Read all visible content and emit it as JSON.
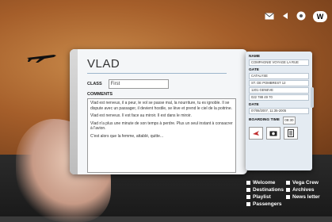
{
  "topbar": {
    "icons": [
      "mail-icon",
      "arrow-left-icon",
      "globe-icon"
    ],
    "badge": "W"
  },
  "card": {
    "title": "VLAD",
    "class_label": "CLASS",
    "class_value": "First",
    "comments_label": "COMMENTS",
    "comments": [
      "Vlad est nerveux, il a peur, le vol se passe mal, la nourriture, tu es ignoble. Il se dispute avec un passager, il devient hostile, se lève et prend le ciel de la poitrine.",
      "Vlad est nerveux. Il est face au miroir. Il est dans le miroir.",
      "Vlad n'a plus une minute de son temps à perdre. Plus un seul instant à consacrer à l'avion.",
      "C'est alors que la femme, attablé, quitte..."
    ]
  },
  "panel": {
    "name_label": "NAME",
    "name_value": "COMPAGNIE VOYAGE LA RUE",
    "gate_label": "GATE",
    "gate_lines": [
      "CATALYSE",
      "ST. DE POMBREST 12",
      "1201 GENEVE",
      "022 788 49 70"
    ],
    "date_label": "DATE",
    "date_value": "07/08/2007, 11:35-2005",
    "boarding_label": "BOARDING TIME",
    "boarding_value": "09:30",
    "icons": [
      "plane-icon",
      "camera-icon",
      "document-icon"
    ]
  },
  "nav": {
    "items": [
      "Welcome",
      "Vega Crew",
      "Destinations",
      "Archives",
      "Playlist",
      "News letter",
      "Passengers"
    ]
  }
}
